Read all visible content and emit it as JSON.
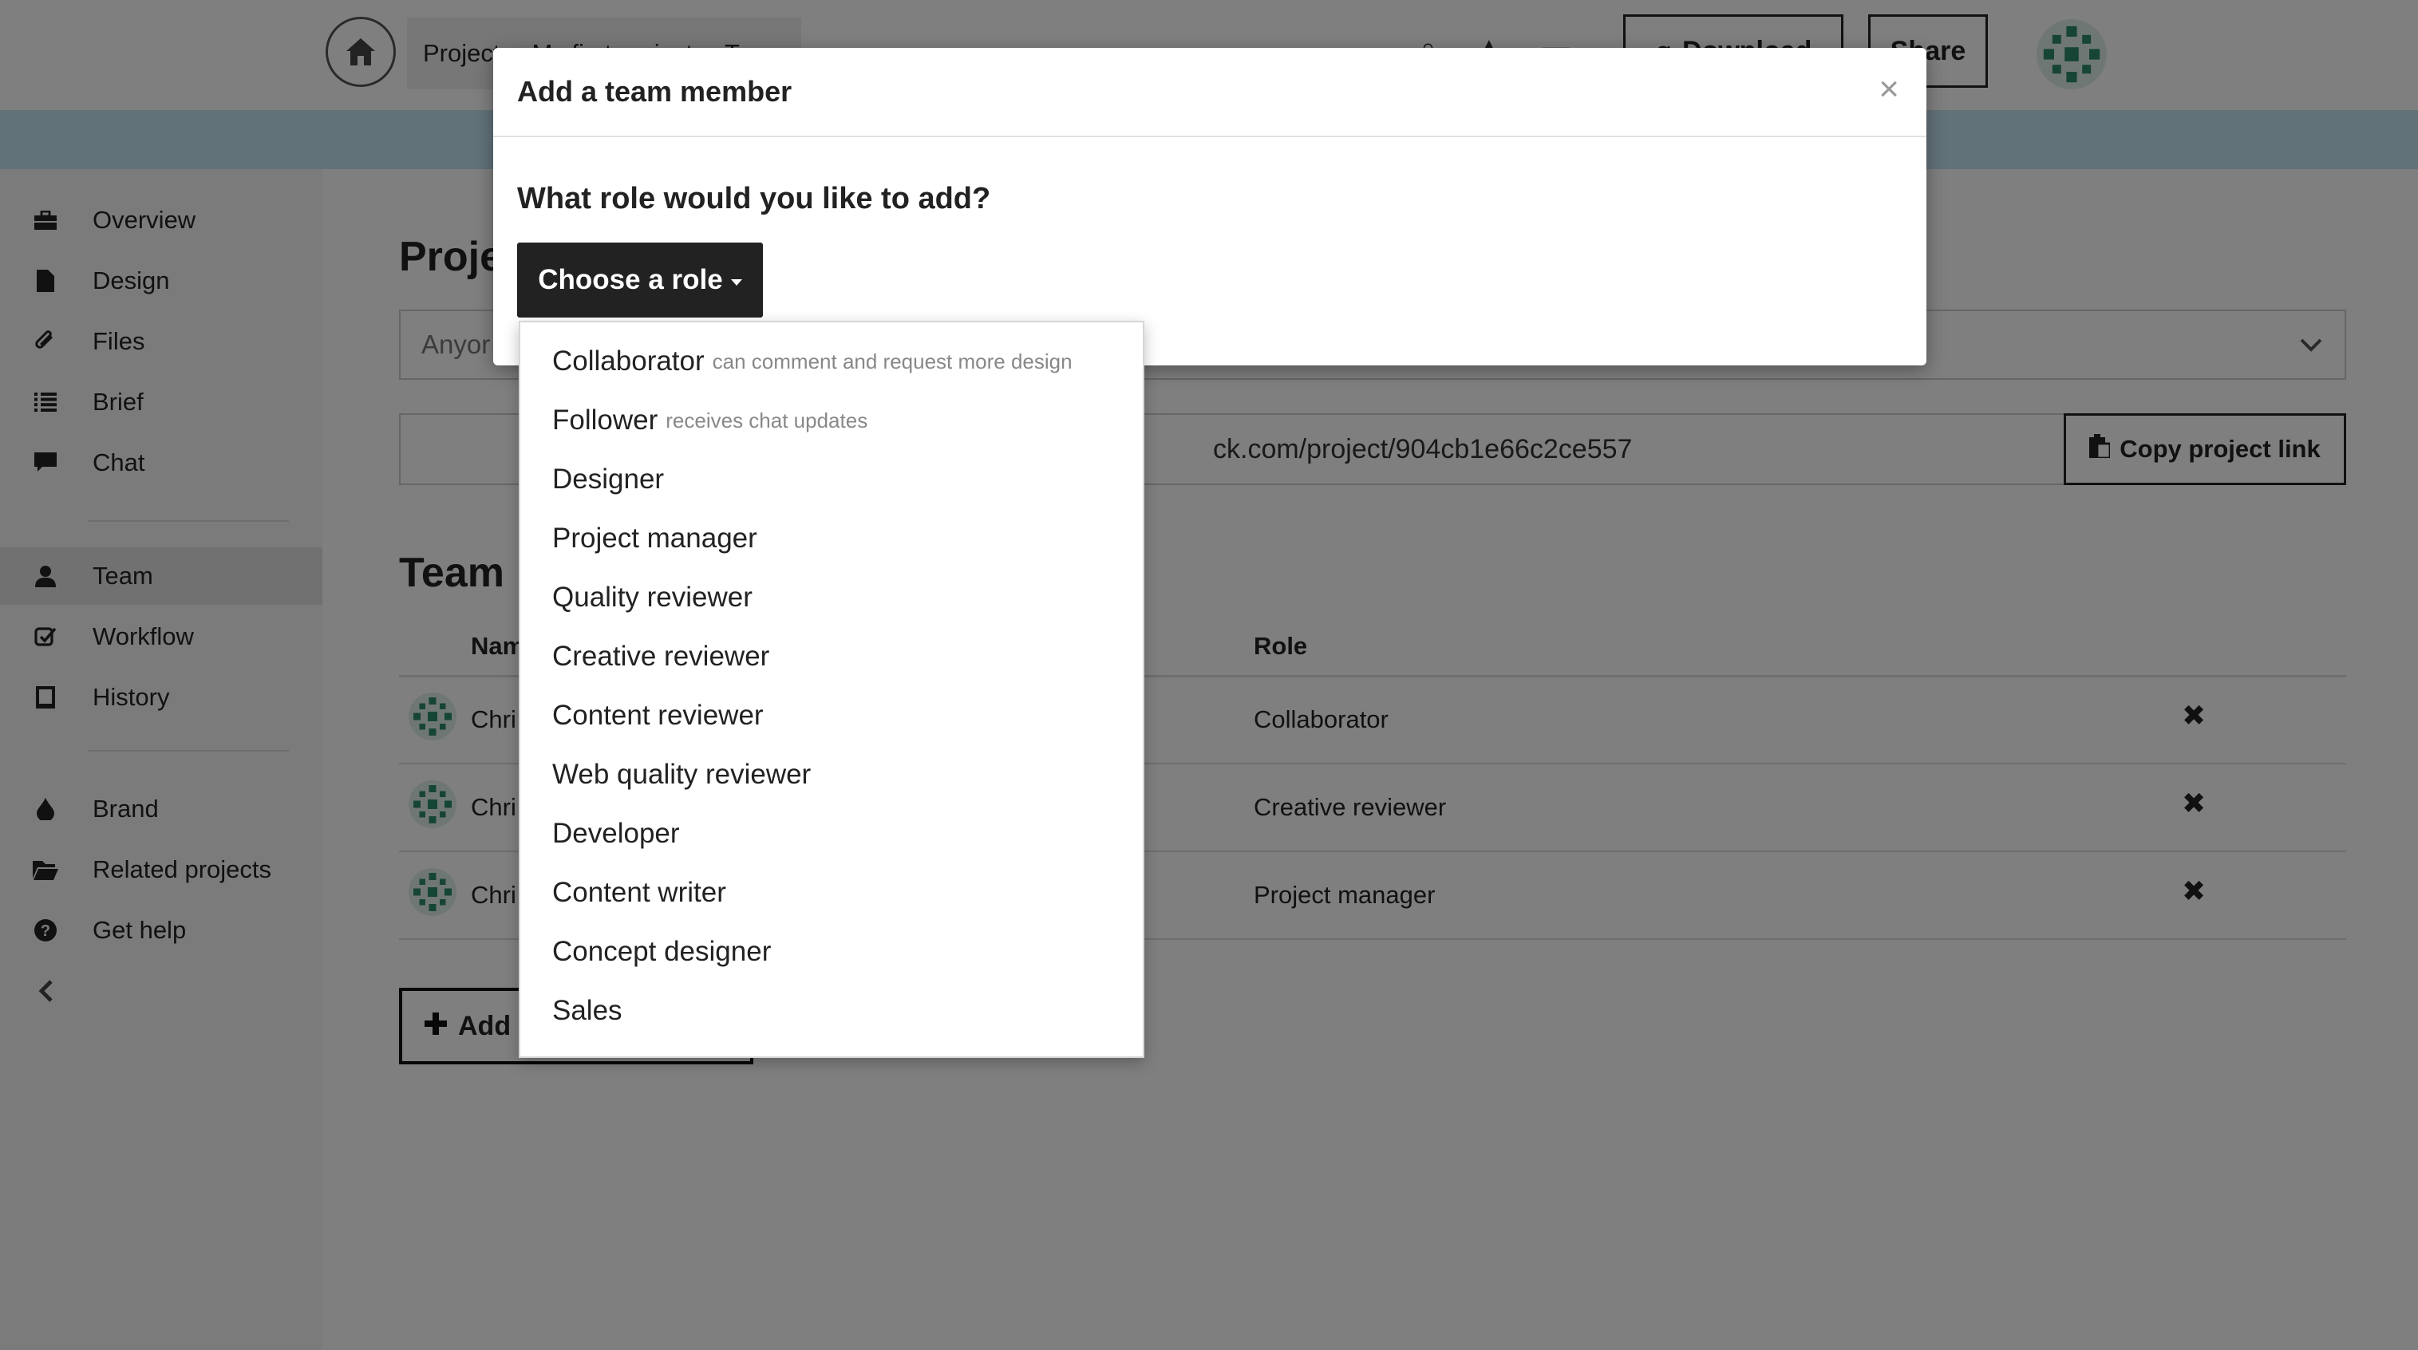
{
  "topbar": {
    "breadcrumb": [
      "Project",
      "My first project",
      "Team"
    ],
    "download_label": "Download",
    "share_label": "Share"
  },
  "sidebar": {
    "items": [
      {
        "label": "Overview",
        "icon": "briefcase-icon"
      },
      {
        "label": "Design",
        "icon": "file-icon"
      },
      {
        "label": "Files",
        "icon": "paperclip-icon"
      },
      {
        "label": "Brief",
        "icon": "list-icon"
      },
      {
        "label": "Chat",
        "icon": "chat-bubble-icon"
      },
      {
        "label": "Team",
        "icon": "user-icon",
        "active": true
      },
      {
        "label": "Workflow",
        "icon": "checkbox-icon"
      },
      {
        "label": "History",
        "icon": "book-icon"
      },
      {
        "label": "Brand",
        "icon": "drop-icon"
      },
      {
        "label": "Related projects",
        "icon": "folder-icon"
      },
      {
        "label": "Get help",
        "icon": "help-icon"
      }
    ],
    "collapse_icon": "chevron-left-icon"
  },
  "main": {
    "project_section_title": "Proje",
    "visibility_value": "Anyor",
    "project_link": "ck.com/project/904cb1e66c2ce557",
    "copy_link_label": "Copy project link",
    "team_title": "Team",
    "table": {
      "headers": [
        "Nam",
        "Role"
      ],
      "rows": [
        {
          "name": "Chri",
          "role": "Collaborator"
        },
        {
          "name": "Chri",
          "role": "Creative reviewer"
        },
        {
          "name": "Chri",
          "role": "Project manager"
        }
      ]
    },
    "add_member_label": "Add"
  },
  "modal": {
    "title": "Add a team member",
    "question": "What role would you like to add?",
    "role_button_label": "Choose a role",
    "options": [
      {
        "label": "Collaborator",
        "hint": "can comment and request more design"
      },
      {
        "label": "Follower",
        "hint": "receives chat updates"
      },
      {
        "label": "Designer",
        "hint": ""
      },
      {
        "label": "Project manager",
        "hint": ""
      },
      {
        "label": "Quality reviewer",
        "hint": ""
      },
      {
        "label": "Creative reviewer",
        "hint": ""
      },
      {
        "label": "Content reviewer",
        "hint": ""
      },
      {
        "label": "Web quality reviewer",
        "hint": ""
      },
      {
        "label": "Developer",
        "hint": ""
      },
      {
        "label": "Content writer",
        "hint": ""
      },
      {
        "label": "Concept designer",
        "hint": ""
      },
      {
        "label": "Sales",
        "hint": ""
      }
    ]
  },
  "colors": {
    "banner": "#c4e4f2",
    "dark_button": "#222222",
    "avatar_green": "#2e8b6a"
  }
}
